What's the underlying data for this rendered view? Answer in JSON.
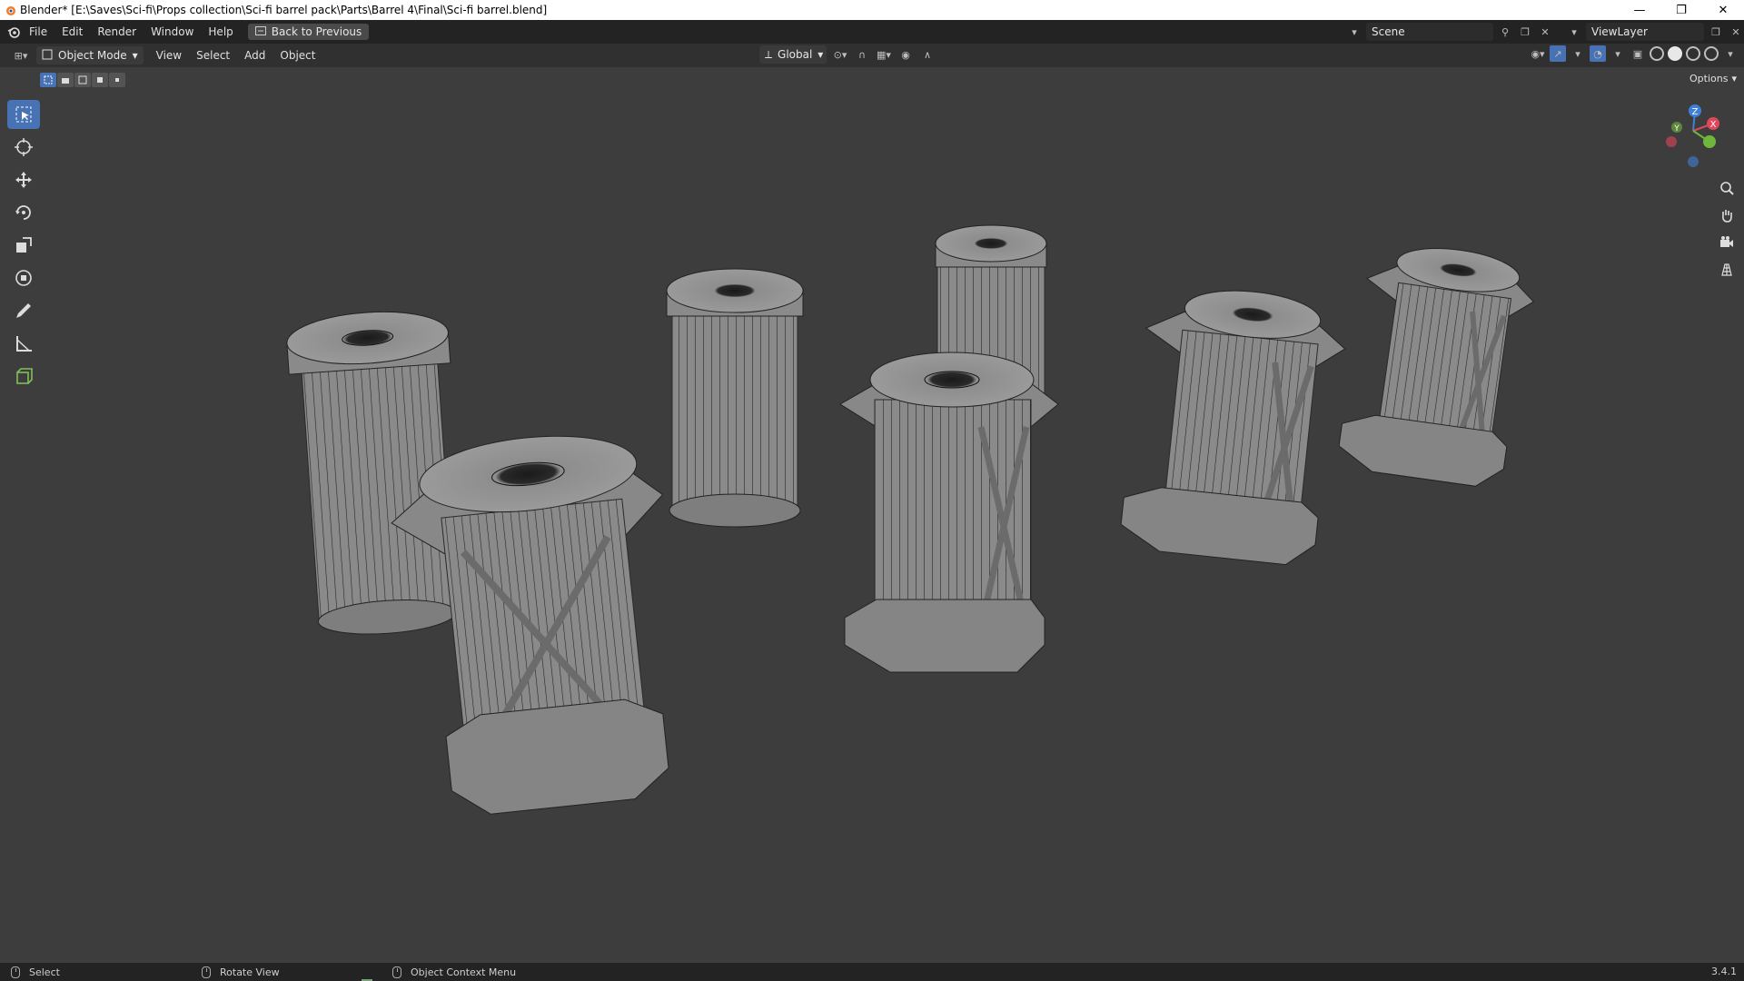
{
  "titlebar": {
    "title": "Blender* [E:\\Saves\\Sci-fi\\Props collection\\Sci-fi barrel pack\\Parts\\Barrel 4\\Final\\Sci-fi barrel.blend]",
    "app_icon": "blender-logo-icon",
    "minimize": "—",
    "restore": "❐",
    "close": "✕"
  },
  "menubar": {
    "items": [
      "File",
      "Edit",
      "Render",
      "Window",
      "Help"
    ],
    "back_button": "Back to Previous",
    "scene_label": "Scene",
    "viewlayer_label": "ViewLayer"
  },
  "header": {
    "mode": "Object Mode",
    "menus": [
      "View",
      "Select",
      "Add",
      "Object"
    ],
    "orientation": "Global",
    "options": "Options"
  },
  "statusbar": {
    "select": "Select",
    "rotate": "Rotate View",
    "context": "Object Context Menu",
    "version": "3.4.1"
  },
  "colors": {
    "accent": "#4772b3",
    "viewport_bg": "#3d3d3d",
    "x_axis": "#e0485a",
    "y_axis": "#6fb73a",
    "z_axis": "#3f7fd9"
  },
  "gizmo": {
    "x": "X",
    "y": "Y",
    "z": "Z"
  }
}
